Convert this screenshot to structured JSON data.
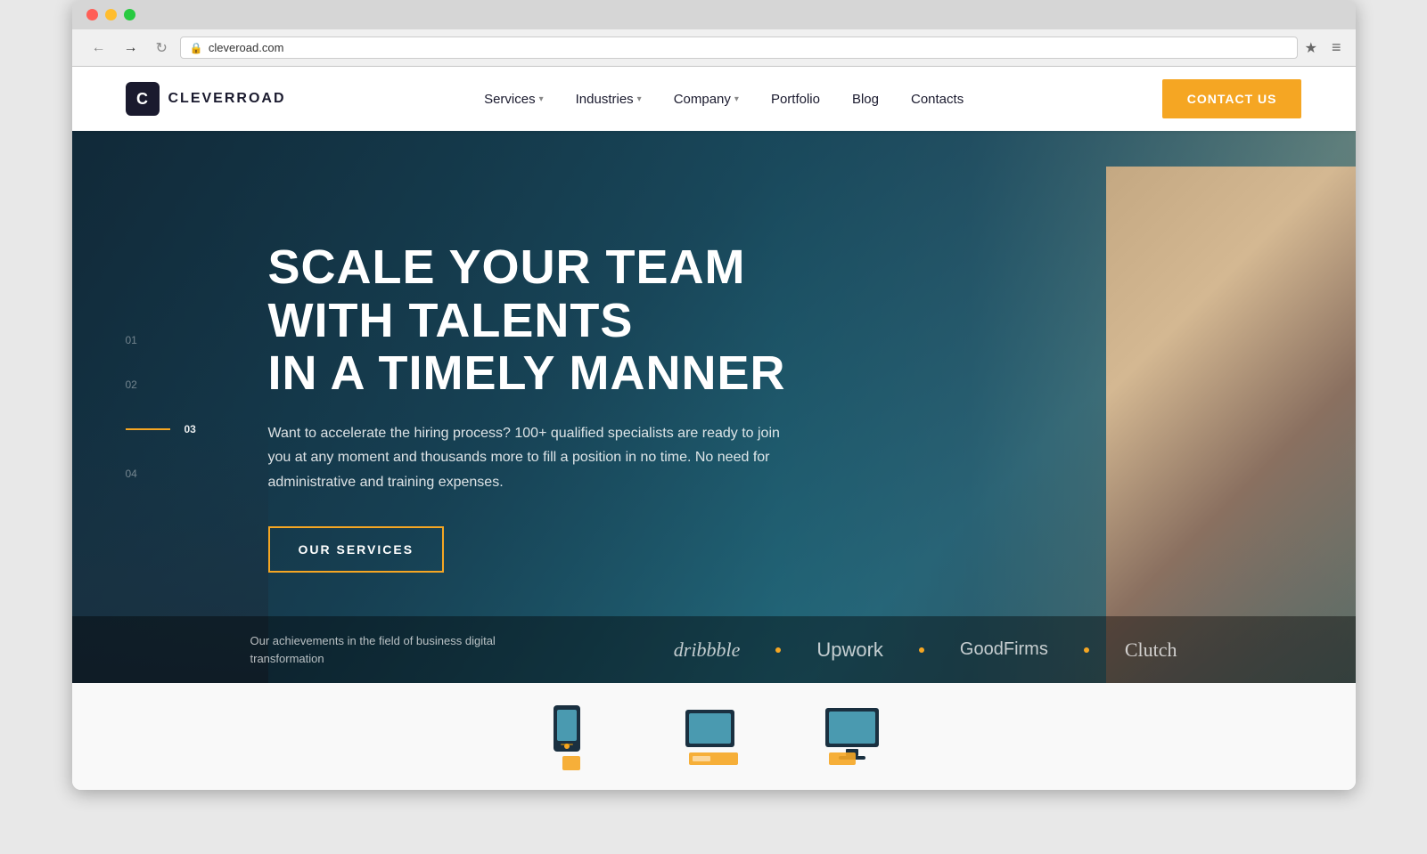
{
  "browser": {
    "dots": [
      "red",
      "yellow",
      "green"
    ],
    "back_icon": "←",
    "forward_icon": "→",
    "reload_icon": "↻",
    "lock_icon": "🔒",
    "address": "cleveroad.com",
    "star_icon": "★",
    "menu_icon": "≡"
  },
  "navbar": {
    "logo_letter": "C",
    "logo_text": "CLEVERROAD",
    "nav_items": [
      {
        "label": "Services",
        "has_dropdown": true
      },
      {
        "label": "Industries",
        "has_dropdown": true
      },
      {
        "label": "Company",
        "has_dropdown": true
      },
      {
        "label": "Portfolio",
        "has_dropdown": false
      },
      {
        "label": "Blog",
        "has_dropdown": false
      },
      {
        "label": "Contacts",
        "has_dropdown": false
      }
    ],
    "cta_label": "CONTACT US"
  },
  "hero": {
    "slide_indicators": [
      {
        "num": "01",
        "active": false
      },
      {
        "num": "02",
        "active": false
      },
      {
        "num": "03",
        "active": true
      },
      {
        "num": "04",
        "active": false
      }
    ],
    "title_line1": "SCALE YOUR TEAM WITH TALENTS",
    "title_line2": "IN A TIMELY MANNER",
    "description": "Want to accelerate the hiring process? 100+ qualified specialists are ready to join you at any moment and thousands more to fill a position in no time. No need for administrative and training expenses.",
    "cta_label": "OUR SERVICES",
    "bottom_text_line1": "Our achievements in the field of business digital",
    "bottom_text_line2": "transformation",
    "partners": [
      {
        "name": "dribbble",
        "class": "dribbble"
      },
      {
        "name": "Upwork",
        "class": "upwork"
      },
      {
        "name": "GoodFirms",
        "class": "goodfirms"
      },
      {
        "name": "Clutch",
        "class": "clutch"
      }
    ]
  },
  "below_fold": {
    "visible": true
  }
}
